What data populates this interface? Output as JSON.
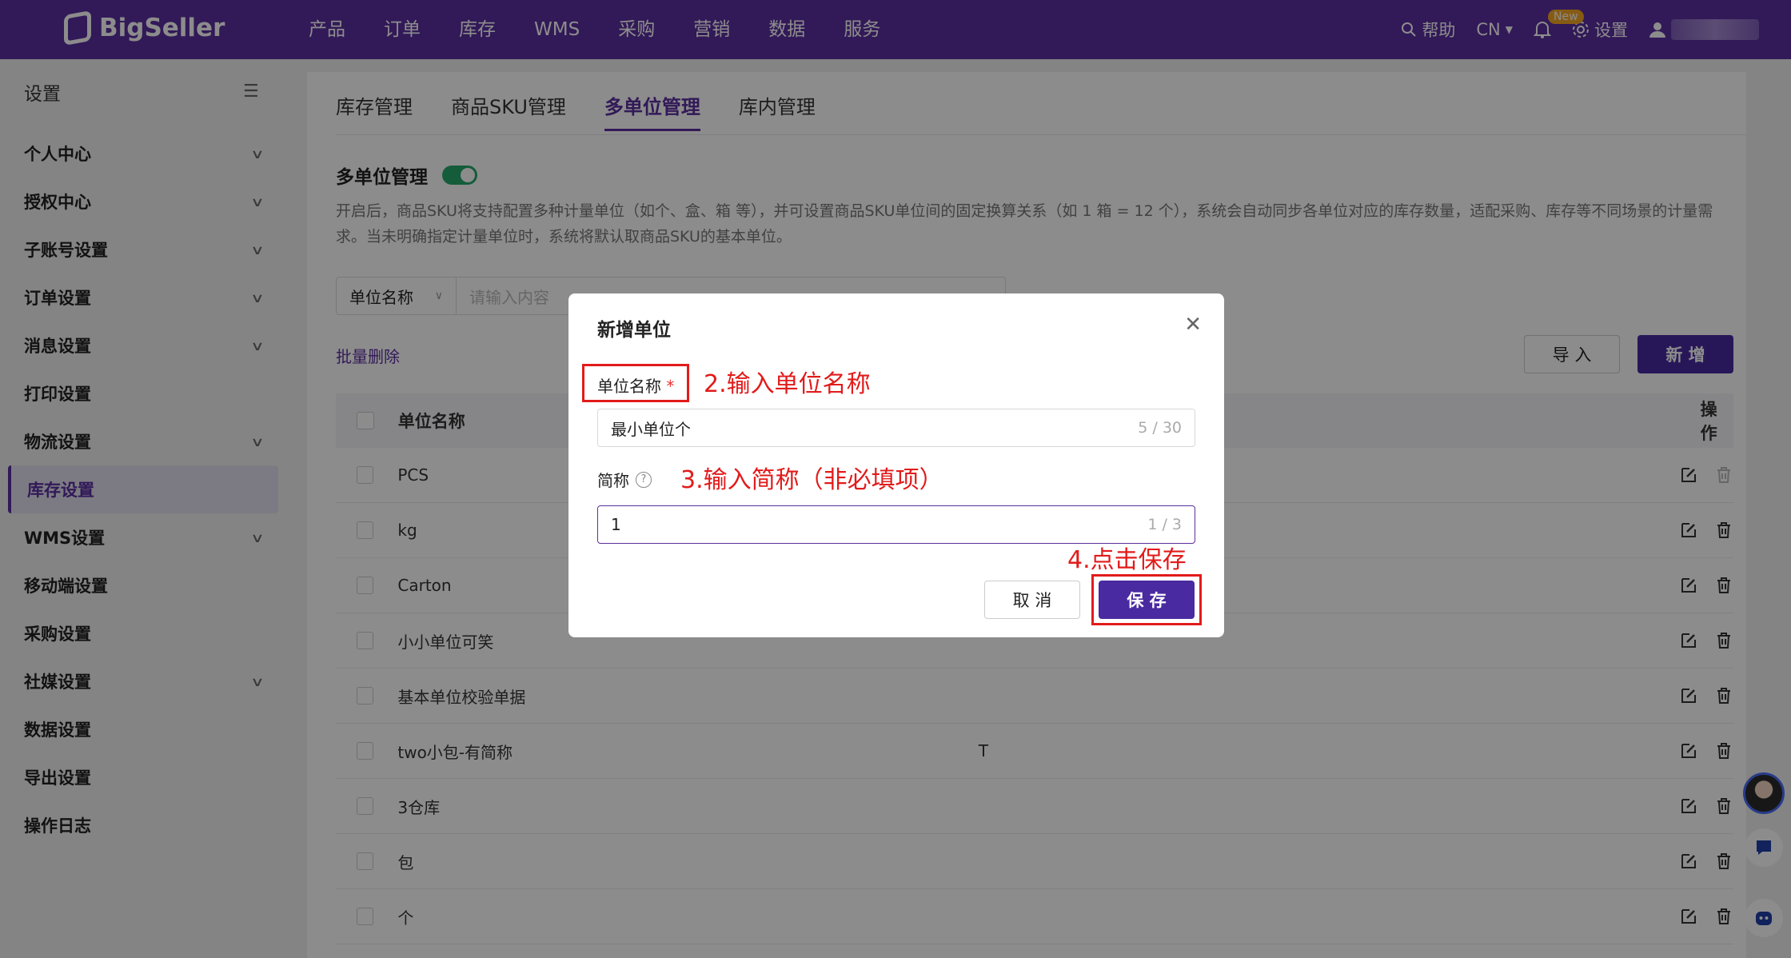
{
  "nav": {
    "logo": "BigSeller",
    "items": [
      "产品",
      "订单",
      "库存",
      "WMS",
      "采购",
      "营销",
      "数据",
      "服务"
    ],
    "help": "帮助",
    "lang": "CN",
    "new_badge": "New",
    "settings": "设置"
  },
  "sidebar": {
    "title": "设置",
    "items": [
      {
        "label": "个人中心",
        "expandable": true
      },
      {
        "label": "授权中心",
        "expandable": true
      },
      {
        "label": "子账号设置",
        "expandable": true
      },
      {
        "label": "订单设置",
        "expandable": true
      },
      {
        "label": "消息设置",
        "expandable": true
      },
      {
        "label": "打印设置",
        "expandable": false
      },
      {
        "label": "物流设置",
        "expandable": true
      },
      {
        "label": "库存设置",
        "expandable": false,
        "active": true
      },
      {
        "label": "WMS设置",
        "expandable": true
      },
      {
        "label": "移动端设置",
        "expandable": false
      },
      {
        "label": "采购设置",
        "expandable": false
      },
      {
        "label": "社媒设置",
        "expandable": true
      },
      {
        "label": "数据设置",
        "expandable": false
      },
      {
        "label": "导出设置",
        "expandable": false
      },
      {
        "label": "操作日志",
        "expandable": false
      }
    ]
  },
  "tabs": [
    "库存管理",
    "商品SKU管理",
    "多单位管理",
    "库内管理"
  ],
  "section": {
    "title": "多单位管理",
    "enabled": true,
    "description": "开启后，商品SKU将支持配置多种计量单位（如个、盒、箱 等），并可设置商品SKU单位间的固定换算关系（如 1 箱 = 12 个），系统会自动同步各单位对应的库存数量，适配采购、库存等不同场景的计量需求。当未明确指定计量单位时，系统将默认取商品SKU的基本单位。"
  },
  "filter": {
    "select_label": "单位名称",
    "placeholder": "请输入内容"
  },
  "actions": {
    "bulk_delete": "批量删除",
    "import": "导 入",
    "add": "新 增"
  },
  "table": {
    "headers": {
      "name": "单位名称",
      "abbr": "",
      "ops": "操作"
    },
    "rows": [
      {
        "name": "PCS",
        "abbr": ""
      },
      {
        "name": "kg",
        "abbr": ""
      },
      {
        "name": "Carton",
        "abbr": ""
      },
      {
        "name": "小小单位可笑",
        "abbr": ""
      },
      {
        "name": "基本单位校验单据",
        "abbr": ""
      },
      {
        "name": "two小包-有简称",
        "abbr": "T"
      },
      {
        "name": "3仓库",
        "abbr": ""
      },
      {
        "name": "包",
        "abbr": ""
      },
      {
        "name": "个",
        "abbr": ""
      }
    ]
  },
  "modal": {
    "title": "新增单位",
    "name_label": "单位名称",
    "required_mark": "*",
    "name_value": "最小单位个",
    "name_count": "5 / 30",
    "abbr_label": "简称",
    "abbr_value": "1",
    "abbr_count": "1 / 3",
    "cancel": "取 消",
    "save": "保 存"
  },
  "annotations": {
    "step2": "2.输入单位名称",
    "step3": "3.输入简称（非必填项）",
    "step4": "4.点击保存"
  },
  "colors": {
    "brand": "#5b2fa0",
    "primary_button": "#4a2aa0",
    "annotation": "#e21b1b",
    "toggle_on": "#27a86b"
  }
}
